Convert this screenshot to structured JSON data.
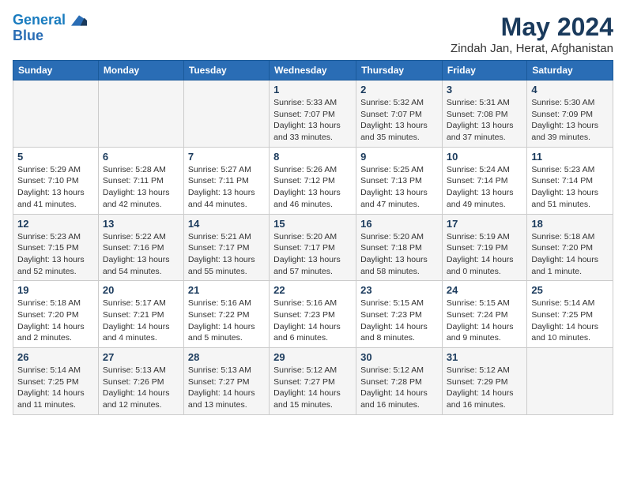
{
  "header": {
    "logo_line1": "General",
    "logo_line2": "Blue",
    "month_year": "May 2024",
    "location": "Zindah Jan, Herat, Afghanistan"
  },
  "weekdays": [
    "Sunday",
    "Monday",
    "Tuesday",
    "Wednesday",
    "Thursday",
    "Friday",
    "Saturday"
  ],
  "weeks": [
    [
      {
        "day": "",
        "info": ""
      },
      {
        "day": "",
        "info": ""
      },
      {
        "day": "",
        "info": ""
      },
      {
        "day": "1",
        "info": "Sunrise: 5:33 AM\nSunset: 7:07 PM\nDaylight: 13 hours\nand 33 minutes."
      },
      {
        "day": "2",
        "info": "Sunrise: 5:32 AM\nSunset: 7:07 PM\nDaylight: 13 hours\nand 35 minutes."
      },
      {
        "day": "3",
        "info": "Sunrise: 5:31 AM\nSunset: 7:08 PM\nDaylight: 13 hours\nand 37 minutes."
      },
      {
        "day": "4",
        "info": "Sunrise: 5:30 AM\nSunset: 7:09 PM\nDaylight: 13 hours\nand 39 minutes."
      }
    ],
    [
      {
        "day": "5",
        "info": "Sunrise: 5:29 AM\nSunset: 7:10 PM\nDaylight: 13 hours\nand 41 minutes."
      },
      {
        "day": "6",
        "info": "Sunrise: 5:28 AM\nSunset: 7:11 PM\nDaylight: 13 hours\nand 42 minutes."
      },
      {
        "day": "7",
        "info": "Sunrise: 5:27 AM\nSunset: 7:11 PM\nDaylight: 13 hours\nand 44 minutes."
      },
      {
        "day": "8",
        "info": "Sunrise: 5:26 AM\nSunset: 7:12 PM\nDaylight: 13 hours\nand 46 minutes."
      },
      {
        "day": "9",
        "info": "Sunrise: 5:25 AM\nSunset: 7:13 PM\nDaylight: 13 hours\nand 47 minutes."
      },
      {
        "day": "10",
        "info": "Sunrise: 5:24 AM\nSunset: 7:14 PM\nDaylight: 13 hours\nand 49 minutes."
      },
      {
        "day": "11",
        "info": "Sunrise: 5:23 AM\nSunset: 7:14 PM\nDaylight: 13 hours\nand 51 minutes."
      }
    ],
    [
      {
        "day": "12",
        "info": "Sunrise: 5:23 AM\nSunset: 7:15 PM\nDaylight: 13 hours\nand 52 minutes."
      },
      {
        "day": "13",
        "info": "Sunrise: 5:22 AM\nSunset: 7:16 PM\nDaylight: 13 hours\nand 54 minutes."
      },
      {
        "day": "14",
        "info": "Sunrise: 5:21 AM\nSunset: 7:17 PM\nDaylight: 13 hours\nand 55 minutes."
      },
      {
        "day": "15",
        "info": "Sunrise: 5:20 AM\nSunset: 7:17 PM\nDaylight: 13 hours\nand 57 minutes."
      },
      {
        "day": "16",
        "info": "Sunrise: 5:20 AM\nSunset: 7:18 PM\nDaylight: 13 hours\nand 58 minutes."
      },
      {
        "day": "17",
        "info": "Sunrise: 5:19 AM\nSunset: 7:19 PM\nDaylight: 14 hours\nand 0 minutes."
      },
      {
        "day": "18",
        "info": "Sunrise: 5:18 AM\nSunset: 7:20 PM\nDaylight: 14 hours\nand 1 minute."
      }
    ],
    [
      {
        "day": "19",
        "info": "Sunrise: 5:18 AM\nSunset: 7:20 PM\nDaylight: 14 hours\nand 2 minutes."
      },
      {
        "day": "20",
        "info": "Sunrise: 5:17 AM\nSunset: 7:21 PM\nDaylight: 14 hours\nand 4 minutes."
      },
      {
        "day": "21",
        "info": "Sunrise: 5:16 AM\nSunset: 7:22 PM\nDaylight: 14 hours\nand 5 minutes."
      },
      {
        "day": "22",
        "info": "Sunrise: 5:16 AM\nSunset: 7:23 PM\nDaylight: 14 hours\nand 6 minutes."
      },
      {
        "day": "23",
        "info": "Sunrise: 5:15 AM\nSunset: 7:23 PM\nDaylight: 14 hours\nand 8 minutes."
      },
      {
        "day": "24",
        "info": "Sunrise: 5:15 AM\nSunset: 7:24 PM\nDaylight: 14 hours\nand 9 minutes."
      },
      {
        "day": "25",
        "info": "Sunrise: 5:14 AM\nSunset: 7:25 PM\nDaylight: 14 hours\nand 10 minutes."
      }
    ],
    [
      {
        "day": "26",
        "info": "Sunrise: 5:14 AM\nSunset: 7:25 PM\nDaylight: 14 hours\nand 11 minutes."
      },
      {
        "day": "27",
        "info": "Sunrise: 5:13 AM\nSunset: 7:26 PM\nDaylight: 14 hours\nand 12 minutes."
      },
      {
        "day": "28",
        "info": "Sunrise: 5:13 AM\nSunset: 7:27 PM\nDaylight: 14 hours\nand 13 minutes."
      },
      {
        "day": "29",
        "info": "Sunrise: 5:12 AM\nSunset: 7:27 PM\nDaylight: 14 hours\nand 15 minutes."
      },
      {
        "day": "30",
        "info": "Sunrise: 5:12 AM\nSunset: 7:28 PM\nDaylight: 14 hours\nand 16 minutes."
      },
      {
        "day": "31",
        "info": "Sunrise: 5:12 AM\nSunset: 7:29 PM\nDaylight: 14 hours\nand 16 minutes."
      },
      {
        "day": "",
        "info": ""
      }
    ]
  ]
}
